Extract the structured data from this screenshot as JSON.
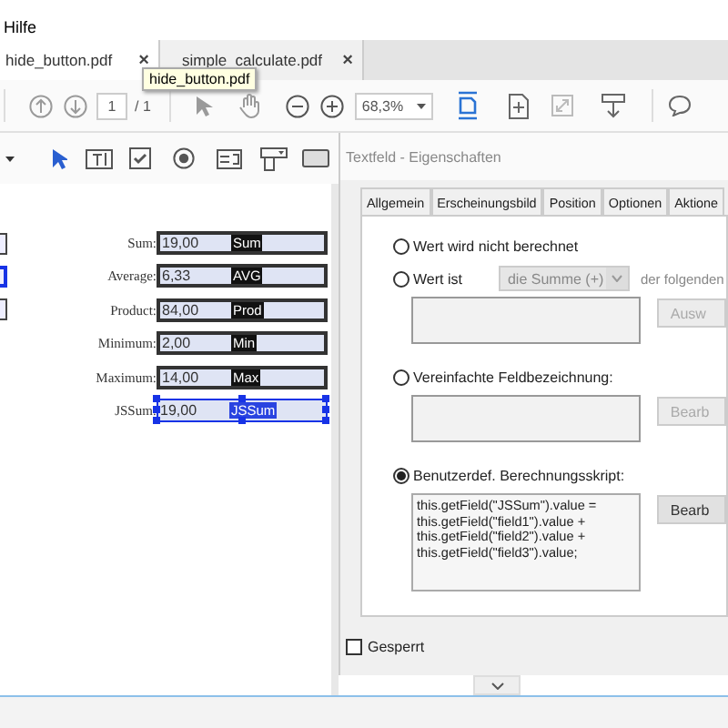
{
  "menu": {
    "items": [
      "Hilfe"
    ]
  },
  "tabs": [
    {
      "label": "hide_button.pdf",
      "selected": true,
      "close": "×"
    },
    {
      "label": "simple_calculate.pdf",
      "selected": false,
      "close": "×"
    }
  ],
  "tooltip": {
    "text": "hide_button.pdf"
  },
  "toolbar": {
    "page": "1",
    "page_total": "/ 1",
    "zoom": "68,3%"
  },
  "page": {
    "partial_fields": [
      {
        "selected": false
      },
      {
        "selected": true
      },
      {
        "selected": false
      }
    ],
    "fields": [
      {
        "label": "Sum:",
        "value": "19,00",
        "name": "Sum",
        "selected": false
      },
      {
        "label": "Average:",
        "value": "6,33",
        "name": "AVG",
        "selected": false
      },
      {
        "label": "Product:",
        "value": "84,00",
        "name": "Prod",
        "selected": false
      },
      {
        "label": "Minimum:",
        "value": "2,00",
        "name": "Min",
        "selected": false
      },
      {
        "label": "Maximum:",
        "value": "14,00",
        "name": "Max",
        "selected": false
      },
      {
        "label": "JSSum:",
        "value": "19,00",
        "name": "JSSum",
        "selected": true
      }
    ]
  },
  "dialog": {
    "title": "Textfeld - Eigenschaften",
    "tabs": [
      {
        "label": "Allgemein",
        "selected": false
      },
      {
        "label": "Erscheinungsbild",
        "selected": false
      },
      {
        "label": "Position",
        "selected": false
      },
      {
        "label": "Optionen",
        "selected": false
      },
      {
        "label": "Aktione",
        "selected": false
      }
    ],
    "options": [
      {
        "label": "Wert wird nicht berechnet",
        "selected": false
      },
      {
        "label": "Wert ist",
        "selected": false,
        "dropdown": {
          "value": "die Summe (+)",
          "disabled": true
        },
        "suffix": "der folgenden",
        "box": {
          "disabled": true
        },
        "button": {
          "label": "Ausw",
          "disabled": true
        }
      },
      {
        "label": "Vereinfachte Feldbezeichnung:",
        "selected": false,
        "box": {
          "disabled": true
        },
        "button": {
          "label": "Bearb",
          "disabled": true
        }
      },
      {
        "label": "Benutzerdef. Berechnungsskript:",
        "selected": true,
        "box": {
          "disabled": false,
          "lines": [
            "this.getField(\"JSSum\").value =",
            "this.getField(\"field1\").value +",
            "this.getField(\"field2\").value +",
            "this.getField(\"field3\").value;"
          ]
        },
        "button": {
          "label": "Bearb",
          "disabled": false
        }
      }
    ],
    "locked": {
      "label": "Gesperrt",
      "checked": false
    }
  }
}
